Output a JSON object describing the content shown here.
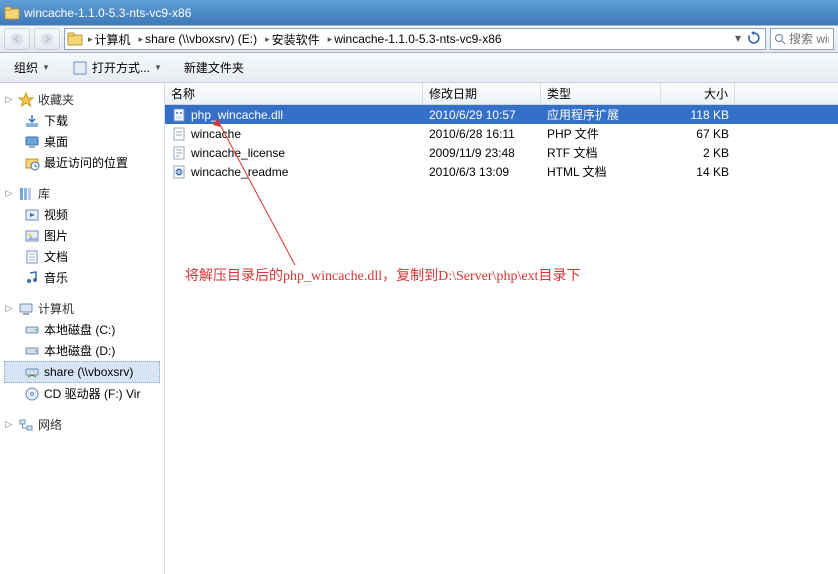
{
  "window": {
    "title": "wincache-1.1.0-5.3-nts-vc9-x86"
  },
  "breadcrumb": {
    "root_icon": "computer-icon",
    "items": [
      {
        "label": "计算机"
      },
      {
        "label": "share (\\\\vboxsrv) (E:)"
      },
      {
        "label": "安装软件"
      },
      {
        "label": "wincache-1.1.0-5.3-nts-vc9-x86"
      }
    ]
  },
  "search": {
    "placeholder": "搜索 win"
  },
  "toolbar": {
    "organize": "组织",
    "openwith": "打开方式...",
    "newfolder": "新建文件夹"
  },
  "nav": {
    "favorites": {
      "label": "收藏夹",
      "items": [
        {
          "label": "下载",
          "icon": "download-icon"
        },
        {
          "label": "桌面",
          "icon": "desktop-icon"
        },
        {
          "label": "最近访问的位置",
          "icon": "recent-icon"
        }
      ]
    },
    "libraries": {
      "label": "库",
      "items": [
        {
          "label": "视频",
          "icon": "video-icon"
        },
        {
          "label": "图片",
          "icon": "picture-icon"
        },
        {
          "label": "文档",
          "icon": "document-icon"
        },
        {
          "label": "音乐",
          "icon": "music-icon"
        }
      ]
    },
    "computer": {
      "label": "计算机",
      "items": [
        {
          "label": "本地磁盘 (C:)",
          "icon": "drive-icon"
        },
        {
          "label": "本地磁盘 (D:)",
          "icon": "drive-icon"
        },
        {
          "label": "share (\\\\vboxsrv)",
          "icon": "netdrive-icon",
          "selected": true
        },
        {
          "label": "CD 驱动器 (F:) Vir",
          "icon": "cd-icon"
        }
      ]
    },
    "network": {
      "label": "网络"
    }
  },
  "columns": {
    "name": "名称",
    "date": "修改日期",
    "type": "类型",
    "size": "大小"
  },
  "files": [
    {
      "name": "php_wincache.dll",
      "date": "2010/6/29 10:57",
      "type": "应用程序扩展",
      "size": "118 KB",
      "icon": "dll-icon",
      "selected": true
    },
    {
      "name": "wincache",
      "date": "2010/6/28 16:11",
      "type": "PHP 文件",
      "size": "67 KB",
      "icon": "php-icon"
    },
    {
      "name": "wincache_license",
      "date": "2009/11/9 23:48",
      "type": "RTF 文档",
      "size": "2 KB",
      "icon": "rtf-icon"
    },
    {
      "name": "wincache_readme",
      "date": "2010/6/3 13:09",
      "type": "HTML 文档",
      "size": "14 KB",
      "icon": "html-icon"
    }
  ],
  "annotation": {
    "text": "将解压目录后的php_wincache.dll，复制到D:\\Server\\php\\ext目录下"
  }
}
